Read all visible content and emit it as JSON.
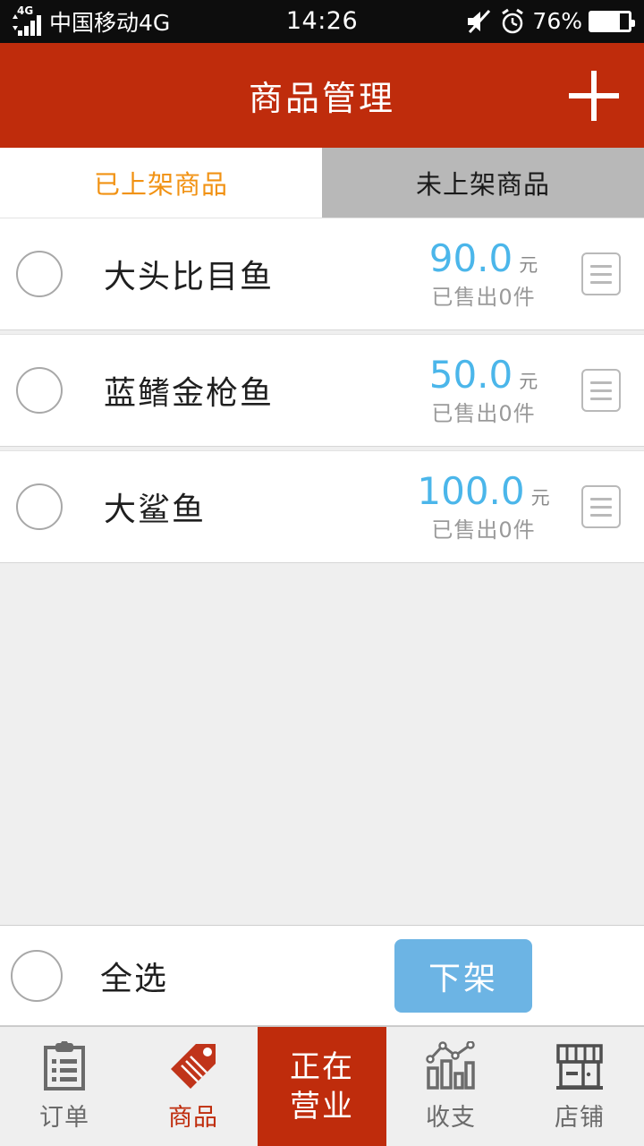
{
  "statusbar": {
    "carrier": "中国移动4G",
    "network_badge": "4G",
    "time": "14:26",
    "battery_percent": "76%",
    "battery_level": 76,
    "icons": [
      "signal-4g-icon",
      "mute-icon",
      "alarm-clock-icon",
      "battery-icon"
    ]
  },
  "header": {
    "title": "商品管理",
    "add_label": "+",
    "bg_color": "#bf2c0c"
  },
  "tabs": [
    {
      "label": "已上架商品",
      "active": true
    },
    {
      "label": "未上架商品",
      "active": false
    }
  ],
  "products": [
    {
      "name": "大头比目鱼",
      "price": "90.0",
      "currency": "元",
      "sold": "已售出0件",
      "selected": false
    },
    {
      "name": "蓝鳍金枪鱼",
      "price": "50.0",
      "currency": "元",
      "sold": "已售出0件",
      "selected": false
    },
    {
      "name": "大鲨鱼",
      "price": "100.0",
      "currency": "元",
      "sold": "已售出0件",
      "selected": false
    }
  ],
  "actionbar": {
    "select_all_label": "全选",
    "select_all_checked": false,
    "button_label": "下架",
    "button_color": "#6cb4e4"
  },
  "bottom_nav": [
    {
      "label": "订单",
      "icon": "clipboard-icon",
      "active": false
    },
    {
      "label": "商品",
      "icon": "tag-icon",
      "active": true
    },
    {
      "label": "正在营业",
      "icon": "",
      "active": false,
      "highlight": true
    },
    {
      "label": "收支",
      "icon": "bar-chart-icon",
      "active": false
    },
    {
      "label": "店铺",
      "icon": "store-icon",
      "active": false
    }
  ],
  "colors": {
    "brand_red": "#bf2c0c",
    "tab_active_text": "#f19213",
    "price_blue": "#4bb6ea",
    "button_blue": "#6cb4e4",
    "page_bg": "#efefef"
  }
}
